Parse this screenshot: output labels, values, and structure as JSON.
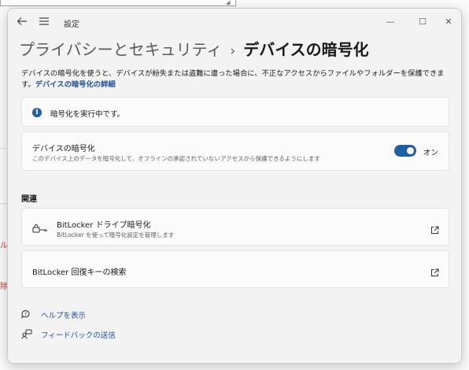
{
  "background": {
    "frag_1": "ル",
    "frag_2": "除"
  },
  "titlebar": {
    "app_title": "設定",
    "back_icon": "back-arrow-icon",
    "menu_icon": "hamburger-icon",
    "minimize": "—",
    "maximize": "☐",
    "close": "✕"
  },
  "breadcrumb": {
    "parent": "プライバシーとセキュリティ",
    "separator": "›",
    "current": "デバイスの暗号化"
  },
  "description": {
    "text": "デバイスの暗号化を使うと、デバイスが紛失または盗難に遭った場合に、不正なアクセスからファイルやフォルダーを保護できます。",
    "link": "デバイスの暗号化の詳細"
  },
  "status": {
    "icon": "info-icon",
    "message": "暗号化を実行中です。"
  },
  "encryption": {
    "title": "デバイスの暗号化",
    "subtitle": "このデバイス上のデータを暗号化して、オフラインの承認されていないアクセスから保護できるようにします",
    "toggle_state": "オン",
    "toggle_on": true,
    "accent": "#1f5fa8"
  },
  "related": {
    "heading": "関連",
    "bitlocker": {
      "title": "BitLocker ドライブ暗号化",
      "subtitle": "BitLocker を使って暗号化設定を管理します",
      "icon": "bitlocker-key-icon"
    },
    "recovery_key": {
      "title": "BitLocker 回復キーの検索"
    },
    "external_icon": "external-link-icon"
  },
  "footer": {
    "help": "ヘルプを表示",
    "feedback": "フィードバックの送信"
  }
}
